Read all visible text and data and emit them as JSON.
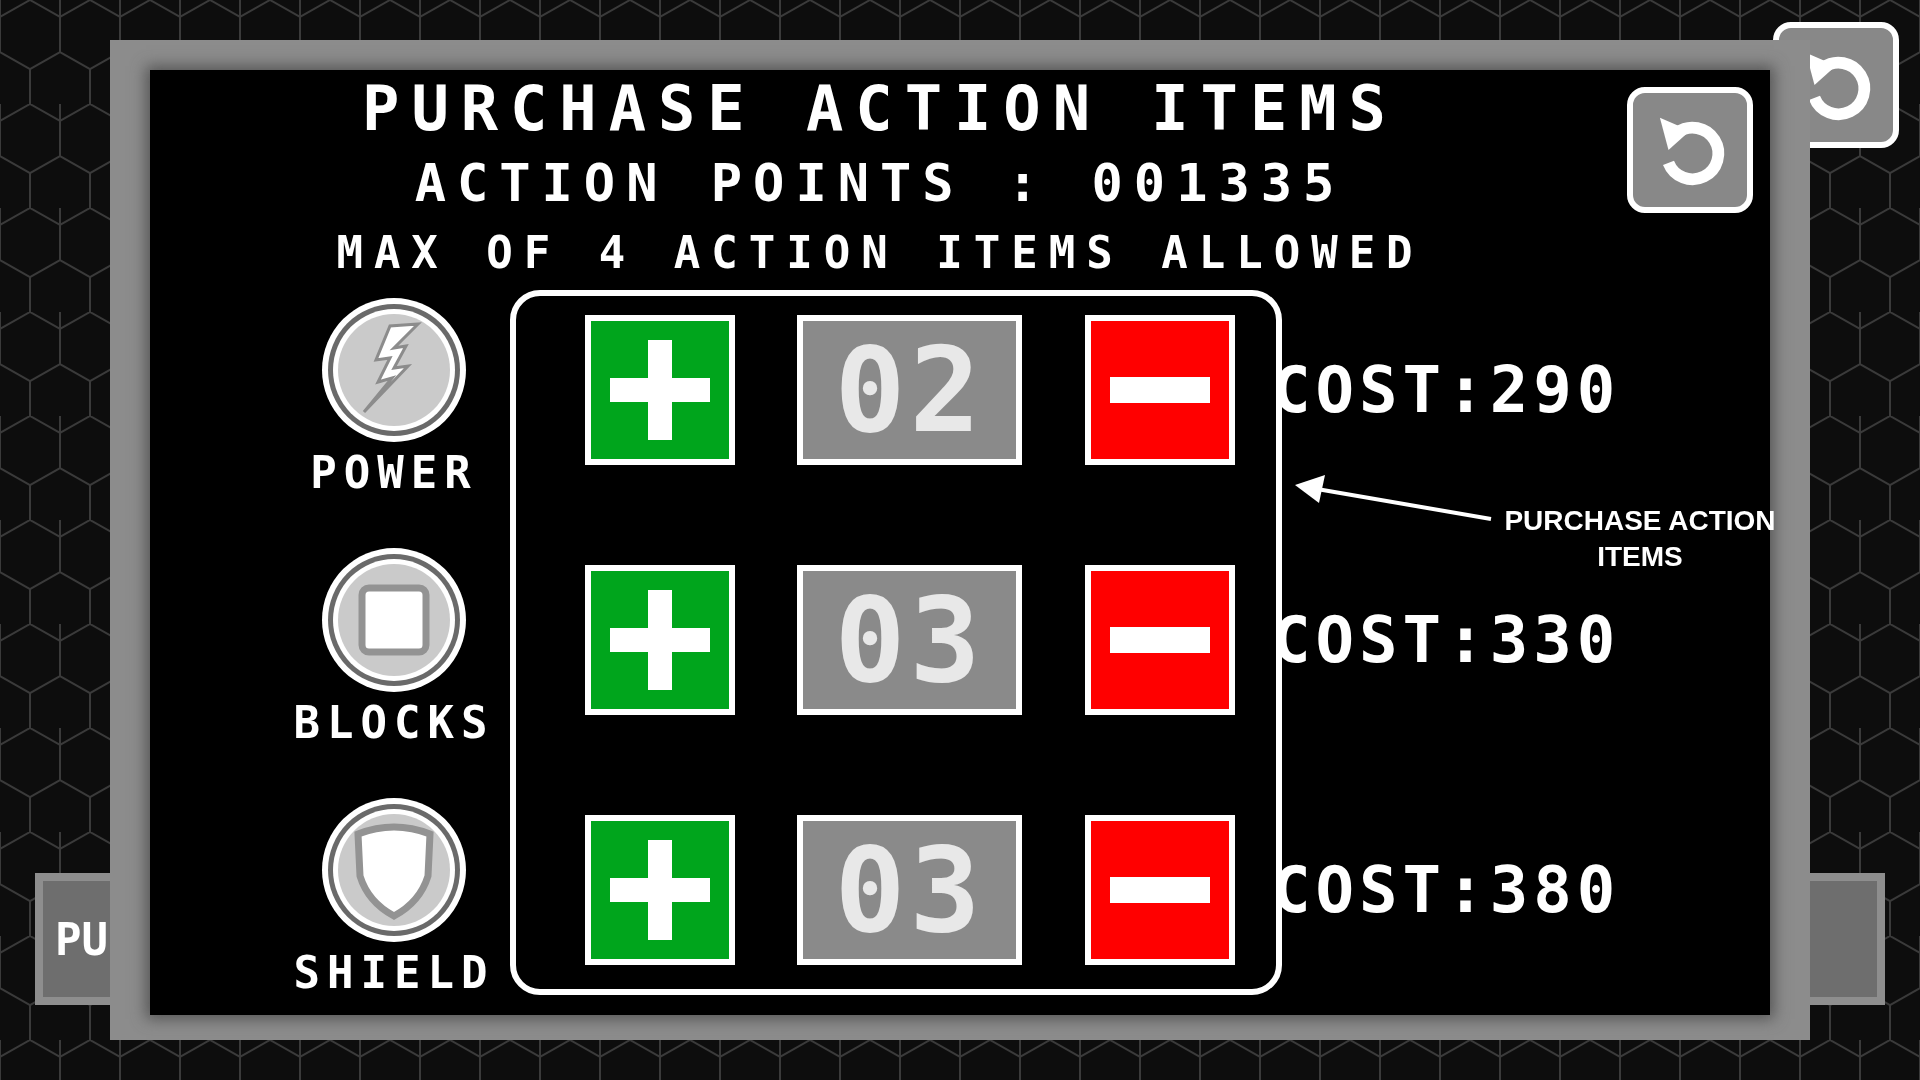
{
  "title": "PURCHASE ACTION ITEMS",
  "points": "ACTION POINTS : 001335",
  "limit": "MAX OF 4 ACTION ITEMS ALLOWED",
  "items": [
    {
      "kind": "power",
      "label": "POWER",
      "count": "02",
      "cost": "COST:290"
    },
    {
      "kind": "blocks",
      "label": "BLOCKS",
      "count": "03",
      "cost": "COST:330"
    },
    {
      "kind": "shield",
      "label": "SHIELD",
      "count": "03",
      "cost": "COST:380"
    }
  ],
  "annotation": "PURCHASE ACTION ITEMS",
  "background_button": "PU"
}
